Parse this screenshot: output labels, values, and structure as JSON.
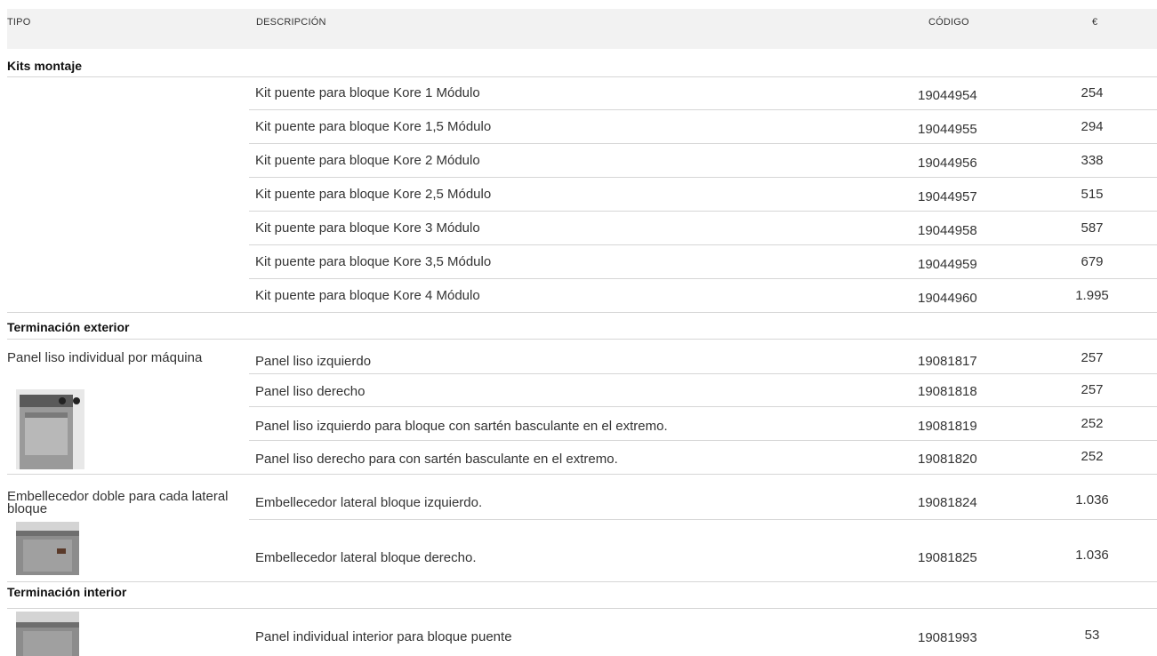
{
  "header": {
    "tipo": "TIPO",
    "descripcion": "DESCRIPCIÓN",
    "codigo": "CÓDIGO",
    "precio": "€"
  },
  "sections": [
    {
      "title": "Kits montaje",
      "groups": [
        {
          "tipo": "",
          "rows": [
            {
              "desc": "Kit puente para bloque Kore 1 Módulo",
              "code": "19044954",
              "price": "254"
            },
            {
              "desc": "Kit puente para bloque Kore 1,5 Módulo",
              "code": "19044955",
              "price": "294"
            },
            {
              "desc": "Kit puente para bloque Kore 2 Módulo",
              "code": "19044956",
              "price": "338"
            },
            {
              "desc": "Kit puente para bloque Kore 2,5 Módulo",
              "code": "19044957",
              "price": "515"
            },
            {
              "desc": "Kit puente para bloque Kore 3 Módulo",
              "code": "19044958",
              "price": "587"
            },
            {
              "desc": "Kit puente para bloque Kore 3,5 Módulo",
              "code": "19044959",
              "price": "679"
            },
            {
              "desc": "Kit puente para bloque Kore 4 Módulo",
              "code": "19044960",
              "price": "1.995"
            }
          ]
        }
      ]
    },
    {
      "title": "Terminación exterior",
      "groups": [
        {
          "tipo": "Panel liso individual por máquina",
          "rows": [
            {
              "desc": "Panel liso izquierdo",
              "code": "19081817",
              "price": "257"
            },
            {
              "desc": "Panel liso derecho",
              "code": "19081818",
              "price": "257"
            },
            {
              "desc": "Panel liso izquierdo para bloque con sartén basculante en el extremo.",
              "code": "19081819",
              "price": "252"
            },
            {
              "desc": "Panel liso derecho para con sartén basculante en el extremo.",
              "code": "19081820",
              "price": "252"
            }
          ]
        },
        {
          "tipo": "Embellecedor doble para cada lateral bloque",
          "rows": [
            {
              "desc": "Embellecedor lateral bloque izquierdo.",
              "code": "19081824",
              "price": "1.036"
            },
            {
              "desc": "Embellecedor lateral bloque derecho.",
              "code": "19081825",
              "price": "1.036"
            }
          ]
        }
      ]
    },
    {
      "title": "Terminación  interior",
      "groups": [
        {
          "tipo": "",
          "rows": [
            {
              "desc": "Panel individual interior para bloque puente",
              "code": "19081993",
              "price": "53"
            }
          ]
        }
      ]
    }
  ]
}
